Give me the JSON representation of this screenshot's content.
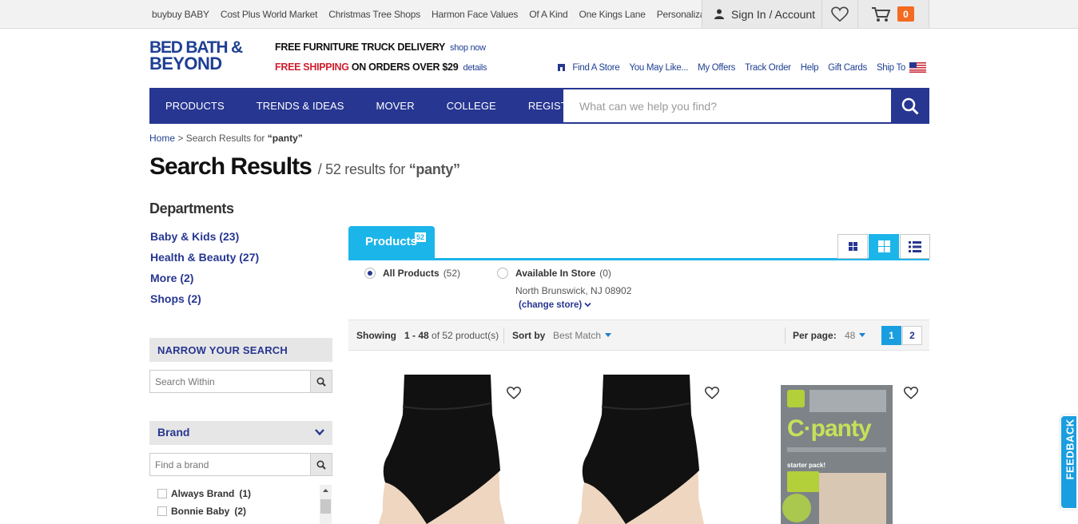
{
  "topbar": {
    "sister_sites": [
      "buybuy BABY",
      "Cost Plus World Market",
      "Christmas Tree Shops",
      "Harmon Face Values",
      "Of A Kind",
      "One Kings Lane",
      "Personalization Mall"
    ],
    "account_label": "Sign In / Account",
    "cart_count": "0"
  },
  "header": {
    "logo_line1": "BED BATH &",
    "logo_line2": "BEYOND",
    "promo1_bold": "FREE FURNITURE TRUCK DELIVERY",
    "promo1_link": "shop now",
    "promo2_red": "FREE SHIPPING",
    "promo2_bold": " ON ORDERS OVER $29",
    "promo2_link": "details",
    "links": [
      "Find A Store",
      "You May Like...",
      "My Offers",
      "Track Order",
      "Help",
      "Gift Cards",
      "Ship To"
    ]
  },
  "nav": {
    "items": [
      "PRODUCTS",
      "TRENDS & IDEAS",
      "MOVER",
      "COLLEGE",
      "REGISTRY"
    ],
    "search_placeholder": "What can we help you find?"
  },
  "breadcrumb": {
    "home": "Home",
    "sep": " > Search Results for ",
    "term": "“panty”"
  },
  "title": {
    "main": "Search Results",
    "sub_prefix": "/ 52 results for ",
    "term": "“panty”"
  },
  "sidebar": {
    "departments_heading": "Departments",
    "departments": [
      "Baby & Kids (23)",
      "Health & Beauty (27)",
      "More (2)",
      "Shops (2)"
    ],
    "narrow_heading": "NARROW YOUR SEARCH",
    "search_within_placeholder": "Search Within",
    "brand_heading": "Brand",
    "find_brand_placeholder": "Find a brand",
    "brands": [
      {
        "name": "Always Brand",
        "count": "(1)"
      },
      {
        "name": "Bonnie Baby",
        "count": "(2)"
      }
    ]
  },
  "results": {
    "tab_label": "Products",
    "tab_count": "52",
    "all_products_label": "All Products",
    "all_products_count": "(52)",
    "in_store_label": "Available In Store",
    "in_store_count": "(0)",
    "store_location": "North Brunswick, NJ 08902",
    "change_store": "(change store)",
    "showing_label": "Showing",
    "showing_range": "1 - 48",
    "showing_total": " of 52 product(s)",
    "sort_label": "Sort by",
    "sort_value": "Best Match",
    "per_page_label": "Per page:",
    "per_page_value": "48",
    "pages": [
      "1",
      "2"
    ]
  },
  "products": [
    {
      "name": "black high-waist shaping panty"
    },
    {
      "name": "black high-waist shaping panty"
    },
    {
      "name": "C-panty box",
      "box_brand": "C·panty",
      "box_small": "starter pack!"
    }
  ],
  "feedback_label": "FEEDBACK",
  "colors": {
    "brand_blue": "#273691",
    "accent_cyan": "#1cb5ea",
    "promo_red": "#d01f2f",
    "cart_orange": "#f26b21"
  }
}
